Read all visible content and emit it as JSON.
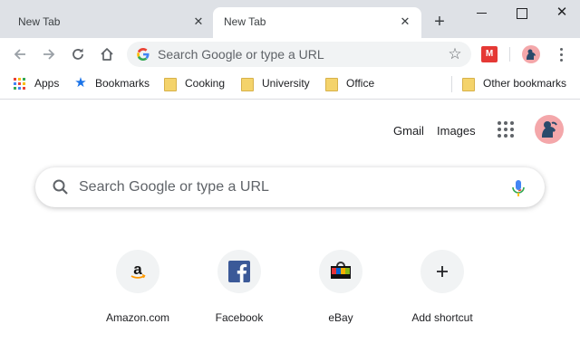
{
  "tabs": [
    {
      "title": "New Tab",
      "active": false
    },
    {
      "title": "New Tab",
      "active": true
    }
  ],
  "window_controls": {
    "close_glyph": "✕"
  },
  "toolbar": {
    "omnibox_placeholder": "Search Google or type a URL",
    "extension_label": "M"
  },
  "bookmarks": {
    "items": [
      {
        "label": "Apps",
        "icon": "apps-grid-icon"
      },
      {
        "label": "Bookmarks",
        "icon": "star-icon"
      },
      {
        "label": "Cooking",
        "icon": "folder-icon"
      },
      {
        "label": "University",
        "icon": "folder-icon"
      },
      {
        "label": "Office",
        "icon": "folder-icon"
      }
    ],
    "other": {
      "label": "Other bookmarks",
      "icon": "folder-icon"
    }
  },
  "header": {
    "gmail_label": "Gmail",
    "images_label": "Images"
  },
  "realbox": {
    "placeholder": "Search Google or type a URL"
  },
  "shortcuts": [
    {
      "label": "Amazon.com",
      "icon": "amazon-icon"
    },
    {
      "label": "Facebook",
      "icon": "facebook-icon"
    },
    {
      "label": "eBay",
      "icon": "ebay-icon"
    },
    {
      "label": "Add shortcut",
      "icon": "plus-icon"
    }
  ],
  "colors": {
    "tabstrip": "#dee1e6",
    "accent_blue": "#1a73e8",
    "avatar_bg": "#f4a7aa",
    "folder": "#f4d36b",
    "extension": "#e53935",
    "facebook": "#3b5998"
  }
}
